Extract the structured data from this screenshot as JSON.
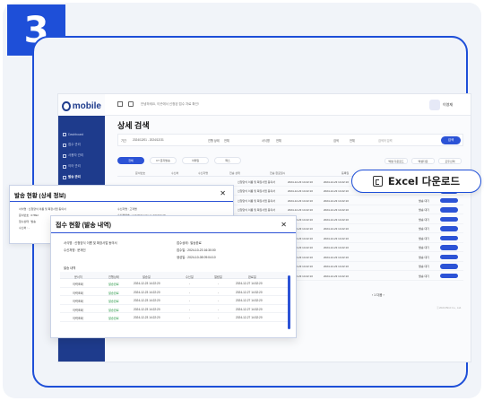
{
  "step_number": "3",
  "app": {
    "logo_text": "mobile",
    "breadcrumb": "안녕하세요, 이곳에서 신청된 접수 자료 확인!",
    "user_name": "이영재",
    "sidebar": [
      "Dashboard",
      "접수 관리",
      "사용자 관리",
      "이어 관리",
      "발송 관리"
    ],
    "page_title": "상세 검색",
    "filter": {
      "period_label": "기간",
      "period_value": "2024/12/01 - 2024/12/31",
      "status_label": "진행 상태",
      "status_value": "전체",
      "type_label": "서식명",
      "type_value": "전체",
      "name_label": "검색",
      "name_value": "전체",
      "search_placeholder": "검색어 입력",
      "search_button": "검색"
    },
    "tabs": [
      "전체",
      "KT 문자발송",
      "이메일",
      "팩스"
    ],
    "tools": [
      "엑셀 다운로드",
      "엑셀다운",
      "모두선택"
    ],
    "table_headers": [
      "문서번호",
      "수신처",
      "수신자명",
      "전송 상태",
      "전송 완료일시",
      "등록일",
      "발송일"
    ],
    "rows": [
      {
        "doc": "신청양식 이름 및 확장사업 동의서",
        "date1": "2024-12-23 14:22:10",
        "date2": "2024-12-23 14:22:10",
        "status": "발송 대기"
      },
      {
        "doc": "신청양식 이름 및 확장사업 동의서",
        "date1": "2024-12-23 14:22:10",
        "date2": "2024-12-23 14:22:10",
        "status": "발송 대기"
      },
      {
        "doc": "신청양식 이름 및 확장사업 동의서",
        "date1": "2024-12-23 14:22:10",
        "date2": "2024-12-23 14:22:10",
        "status": "발송 대기"
      },
      {
        "doc": "신청양식 이름 및 확장사업 동의서",
        "date1": "2024-12-23 14:22:10",
        "date2": "2024-12-23 14:22:10",
        "status": "발송 대기"
      },
      {
        "doc": "신청양식 이름 및 확장사업 동의서",
        "date1": "2024-12-23 14:22:10",
        "date2": "2024-12-23 14:22:10",
        "status": "발송 대기"
      },
      {
        "doc": "신청양식 이름 및 확장사업 동의서",
        "date1": "2024-12-23 14:22:10",
        "date2": "2024-12-23 14:22:10",
        "status": "발송 대기"
      },
      {
        "doc": "신청양식 이름 및 확장사업 동의서",
        "date1": "2024-12-23 14:22:10",
        "date2": "2024-12-23 14:22:10",
        "status": "발송 대기"
      },
      {
        "doc": "신청양식 이름 및 확장사업 동의서",
        "date1": "2024-12-23 14:22:10",
        "date2": "2024-12-23 14:22:10",
        "status": "발송 대기"
      },
      {
        "doc": "신청양식 이름 및 확장사업 동의서",
        "date1": "2024-12-23 14:22:10",
        "date2": "2024-12-23 14:22:10",
        "status": "발송 대기"
      },
      {
        "doc": "신청양식 이름 및 확장사업 동의서",
        "date1": "2024-12-23 14:22:10",
        "date2": "2024-12-23 14:22:10",
        "status": "발송 대기"
      },
      {
        "doc": "신청양식 이름 및 확장사업 동의서",
        "date1": "2024-12-23 14:22:10",
        "date2": "2024-12-23 14:22:10",
        "status": "발송 대기"
      }
    ],
    "pager": "‹  1  다음  ›",
    "copyright": "ⓒ2024 Bird Co., Ltd."
  },
  "modal_send": {
    "title": "발송 현황 (상세 정보)",
    "lines": [
      "서식명 :   신청양식 이름 및 확장사업 동의서",
      "문서번호 :   67892",
      "접수상태 :   발송",
      "수신처 :   -",
      "수신자명 :   고객명",
      "수신처번호 :   amk@domain.co.kr/tel/sty/?...",
      "발송일 :   2024-10-10",
      "완료일 :   -"
    ]
  },
  "modal_receipt": {
    "title": "접수 현황 (발송 내역)",
    "left_lines": [
      "서식명 :   신청양식 이름 및 확장사업 동의서",
      "수신처명 :   문재인"
    ],
    "right_lines": [
      "접수상태 :   발송완료",
      "접수일 :   2024-10-23 16:30:00",
      "생성일 :   2024-10-08 09:04:10"
    ],
    "history_label": "발송 내역",
    "headers": [
      "문서처",
      "진행상태",
      "발송일",
      "수신일",
      "열람일",
      "완료일"
    ],
    "rows": [
      {
        "doc": "이력조회",
        "status": "발송완료",
        "sent": "2024-12-23 14:22:20",
        "recv": "-",
        "read": "-",
        "done": "2024-12-27 14:32:20"
      },
      {
        "doc": "이력조회",
        "status": "발송완료",
        "sent": "2024-12-23 14:22:20",
        "recv": "-",
        "read": "-",
        "done": "2024-12-27 14:32:20"
      },
      {
        "doc": "이력조회",
        "status": "발송완료",
        "sent": "2024-12-23 14:22:20",
        "recv": "-",
        "read": "-",
        "done": "2024-12-27 14:32:20"
      },
      {
        "doc": "이력조회",
        "status": "발송완료",
        "sent": "2024-12-23 14:22:20",
        "recv": "-",
        "read": "-",
        "done": "2024-12-27 14:32:20"
      },
      {
        "doc": "이력조회",
        "status": "발송완료",
        "sent": "2024-12-23 14:22:20",
        "recv": "-",
        "read": "-",
        "done": "2024-12-27 14:32:20"
      }
    ]
  },
  "excel_button": {
    "label": "Excel 다운로드",
    "icon": "excel-file-icon"
  },
  "colors": {
    "accent": "#1e4fd8",
    "sidebar": "#1e3b8c",
    "success": "#2d9a4a"
  }
}
